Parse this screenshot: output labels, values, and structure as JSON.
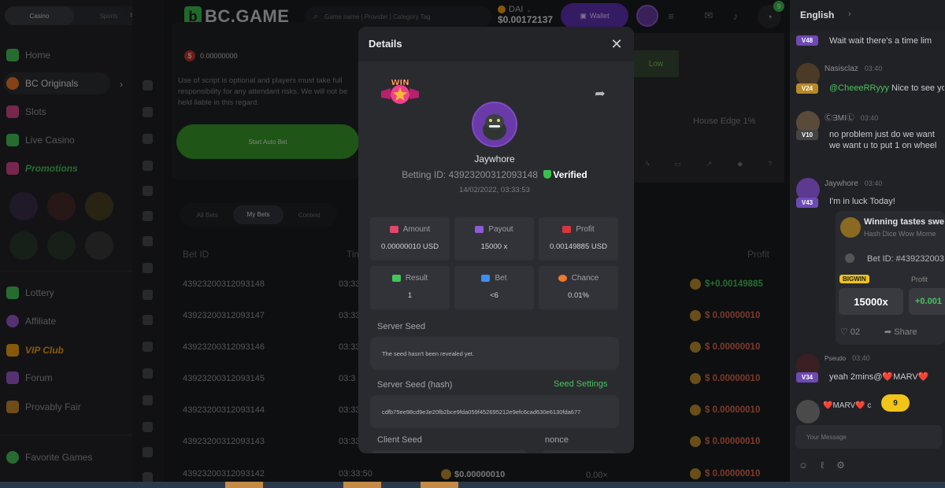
{
  "sidebar": {
    "tabs": [
      "Casino",
      "Sports"
    ],
    "menu_icon": "menu-icon",
    "items": [
      {
        "label": "Home",
        "icon": "home-icon",
        "color": "#45c55a"
      },
      {
        "label": "BC Originals",
        "icon": "originals-icon",
        "color": "#f07a2a"
      },
      {
        "label": "Slots",
        "icon": "slots-icon",
        "color": "#d9478c"
      },
      {
        "label": "Live Casino",
        "icon": "live-casino-icon",
        "color": "#45c55a"
      },
      {
        "label": "Promotions",
        "icon": "promotions-icon",
        "color": "#d9478c"
      },
      {
        "label": "Lottery",
        "icon": "lottery-icon",
        "color": "#45c55a"
      },
      {
        "label": "Affiliate",
        "icon": "affiliate-icon",
        "color": "#9b59d0"
      },
      {
        "label": "VIP Club",
        "icon": "crown-icon",
        "color": "#f2a312"
      },
      {
        "label": "Forum",
        "icon": "forum-icon",
        "color": "#9b59d0"
      },
      {
        "label": "Provably Fair",
        "icon": "fair-icon",
        "color": "#c78b2d"
      },
      {
        "label": "Favorite Games",
        "icon": "star-icon",
        "color": "#45c55a"
      }
    ]
  },
  "topbar": {
    "logo": "BC.GAME",
    "search_placeholder": "Game name | Provider | Category Tag",
    "currency": "DAI",
    "balance": "$0.00172137",
    "wallet_label": "Wallet",
    "notification_count": "9"
  },
  "game": {
    "profit_value": "0.00000000",
    "script_note": "Use of script is optional and players must take full responsibility for any attendant risks. We will not be held liable in this regard.",
    "auto_button": "Start Auto Bet",
    "low_label": "Low",
    "house_edge": "House Edge 1%",
    "bet_tabs": [
      "All Bets",
      "My Bets",
      "Contest"
    ],
    "columns": {
      "bet_id": "Bet ID",
      "time": "Tim",
      "profit": "Profit"
    },
    "rows": [
      {
        "id": "43923200312093148",
        "time": "03:33",
        "profit": "$+0.00149885",
        "positive": true
      },
      {
        "id": "43923200312093147",
        "time": "03:33",
        "profit": "$ 0.00000010",
        "positive": false
      },
      {
        "id": "43923200312093146",
        "time": "03:33",
        "profit": "$ 0.00000010",
        "positive": false
      },
      {
        "id": "43923200312093145",
        "time": "03:3",
        "profit": "$ 0.00000010",
        "positive": false
      },
      {
        "id": "43923200312093144",
        "time": "03:33",
        "profit": "$ 0.00000010",
        "positive": false
      },
      {
        "id": "43923200312093143",
        "time": "03:33",
        "profit": "$ 0.00000010",
        "positive": false
      },
      {
        "id": "43923200312093142",
        "time": "03:33:50",
        "profit": "$ 0.00000010",
        "positive": false
      }
    ],
    "last_row_amount": "$0.00000010",
    "last_row_multiplier": "0.00×"
  },
  "modal": {
    "title": "Details",
    "win_badge": "WIN",
    "username": "Jaywhore",
    "betting_id_label": "Betting ID:",
    "betting_id": "43923200312093148",
    "verified": "Verified",
    "date": "14/02/2022, 03:33:53",
    "stats": [
      {
        "label": "Amount",
        "value": "0.00000010 USD",
        "icon": "amount-icon",
        "color": "#e0476a"
      },
      {
        "label": "Payout",
        "value": "15000 x",
        "icon": "payout-icon",
        "color": "#8b5bd6"
      },
      {
        "label": "Profit",
        "value": "0.00149885 USD",
        "icon": "profit-icon",
        "color": "#d9363b"
      },
      {
        "label": "Result",
        "value": "1",
        "icon": "result-icon",
        "color": "#45c55a"
      },
      {
        "label": "Bet",
        "value": "<6",
        "icon": "bet-icon",
        "color": "#3d8ef0"
      },
      {
        "label": "Chance",
        "value": "0.01%",
        "icon": "chance-icon",
        "color": "#f07a2a"
      }
    ],
    "server_seed_label": "Server Seed",
    "server_seed_value": "The seed hasn't been revealed yet.",
    "server_seed_hash_label": "Server Seed (hash)",
    "seed_settings": "Seed Settings",
    "server_seed_hash": "cdfb75ee98cd9e3e20fb2bce9fda059f452695212e9efc6cad630e6130fda677",
    "client_seed_label": "Client Seed",
    "nonce_label": "nonce"
  },
  "chat": {
    "language": "English",
    "messages": [
      {
        "level": "V48",
        "name": "",
        "time": "",
        "text": "Wait wait there's a time lim"
      },
      {
        "level": "V24",
        "name": "Nasisclaz",
        "time": "03:40",
        "mention": "@CheeeRRyyy",
        "text": " Nice to see yo"
      },
      {
        "level": "V10",
        "name": "ⒸƎMIⓁ",
        "time": "03:40",
        "text": "no problem just do we want we want u to put 1 on wheel"
      },
      {
        "level": "V43",
        "name": "Jaywhore",
        "time": "03:40",
        "text": "I'm in luck Today!"
      },
      {
        "level": "V34",
        "name": "Pseudo",
        "time": "03:40",
        "text": "yeah 2mins@❤️MARV❤️"
      },
      {
        "level": "",
        "name": "",
        "time": "",
        "text": "❤️MARV❤️ c"
      }
    ],
    "win_card": {
      "title": "Winning tastes swe",
      "subtitle": "Hash Dice Wow Mome",
      "bet_id": "Bet ID: #439232003",
      "bigwin": "BIGWIN",
      "multiplier": "15000x",
      "profit_label": "Profit",
      "profit_value": "+0.001",
      "likes": "02",
      "share": "Share"
    },
    "new_count": "9",
    "input_placeholder": "Your Message"
  }
}
